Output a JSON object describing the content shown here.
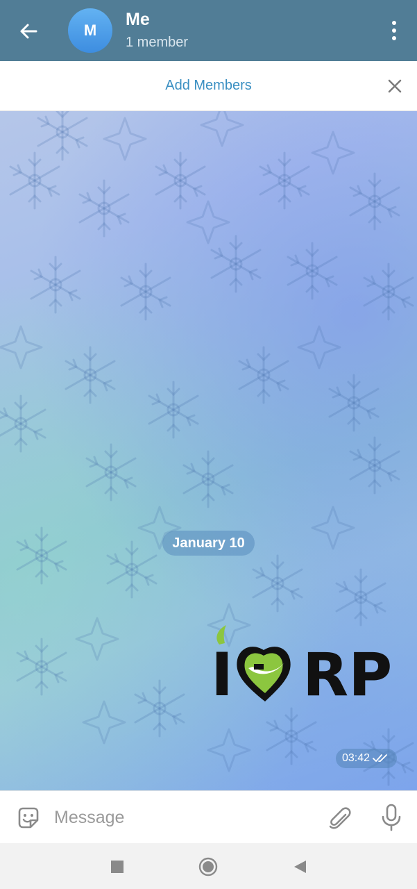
{
  "header": {
    "title": "Me",
    "subtitle": "1 member",
    "avatar_letter": "M",
    "bg_color": "#517d96",
    "back_icon": "arrow-left-icon",
    "menu_icon": "more-vertical-icon"
  },
  "add_bar": {
    "label": "Add Members",
    "close_icon": "close-icon",
    "label_color": "#3a8fc2"
  },
  "chat": {
    "date_label": "January 10",
    "message": {
      "type": "sticker",
      "sticker_letter": "I",
      "sticker_text": "RP",
      "time": "03:42",
      "status_icon": "double-check-icon"
    }
  },
  "input": {
    "placeholder": "Message",
    "emoji_icon": "sticker-icon",
    "attach_icon": "paperclip-icon",
    "mic_icon": "microphone-icon"
  },
  "system_nav": {
    "recents_icon": "square-icon",
    "home_icon": "circle-icon",
    "back_icon": "triangle-back-icon"
  }
}
